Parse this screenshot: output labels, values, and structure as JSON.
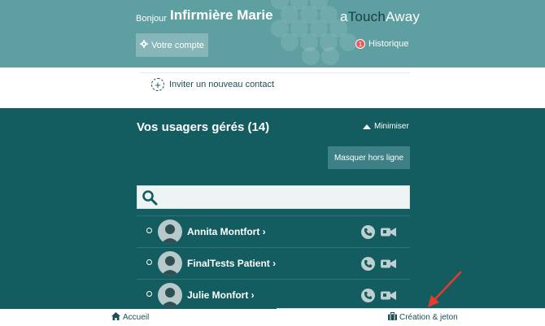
{
  "header": {
    "greeting": "Bonjour",
    "user_name": "Infirmière Marie",
    "logo": {
      "part1": "a",
      "part2": "Touch",
      "part3": "Away"
    },
    "account_button": "Votre compte",
    "history": {
      "label": "Historique",
      "count": "1"
    },
    "background_color": "#5e9fa2"
  },
  "invite": {
    "label": "Inviter un nouveau contact"
  },
  "managed_users": {
    "title": "Vos usagers gérés (14)",
    "minimize_label": "Minimiser",
    "hide_offline_button": "Masquer hors ligne",
    "search": {
      "value": "",
      "placeholder": ""
    },
    "users": [
      {
        "name": "Annita Montfort ›"
      },
      {
        "name": "FinalTests Patient ›"
      },
      {
        "name": "Julie Monfort ›"
      }
    ],
    "panel_color": "#135c60"
  },
  "bottom_nav": {
    "home": "Accueil",
    "creation": "Création & jeton"
  },
  "annotation": {
    "arrow_color": "#e53b2b"
  }
}
